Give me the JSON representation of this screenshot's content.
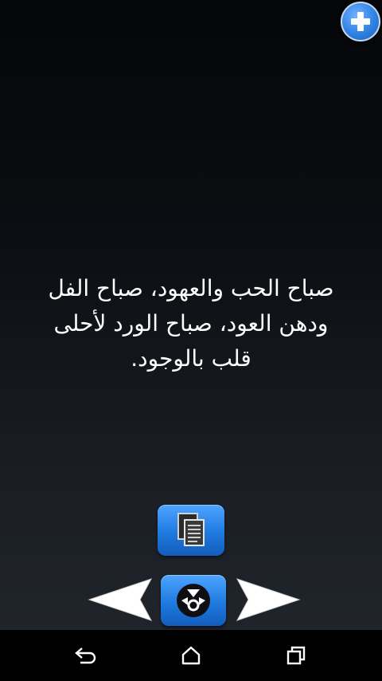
{
  "quote": {
    "lines": [
      "صباح الحب والعهود، صباح الفل",
      "ودهن العود، صباح الورد لأحلى",
      "قلب بالوجود."
    ]
  },
  "icons": {
    "add": "plus-icon",
    "copy": "copy-document-icon",
    "share": "share-icon",
    "prev": "left-arrow-icon",
    "next": "right-arrow-icon",
    "back": "back-icon",
    "home": "home-icon",
    "recent": "recent-apps-icon"
  },
  "colors": {
    "accent": "#2c7fe0",
    "text": "#ffffff",
    "navbar": "#000000"
  }
}
